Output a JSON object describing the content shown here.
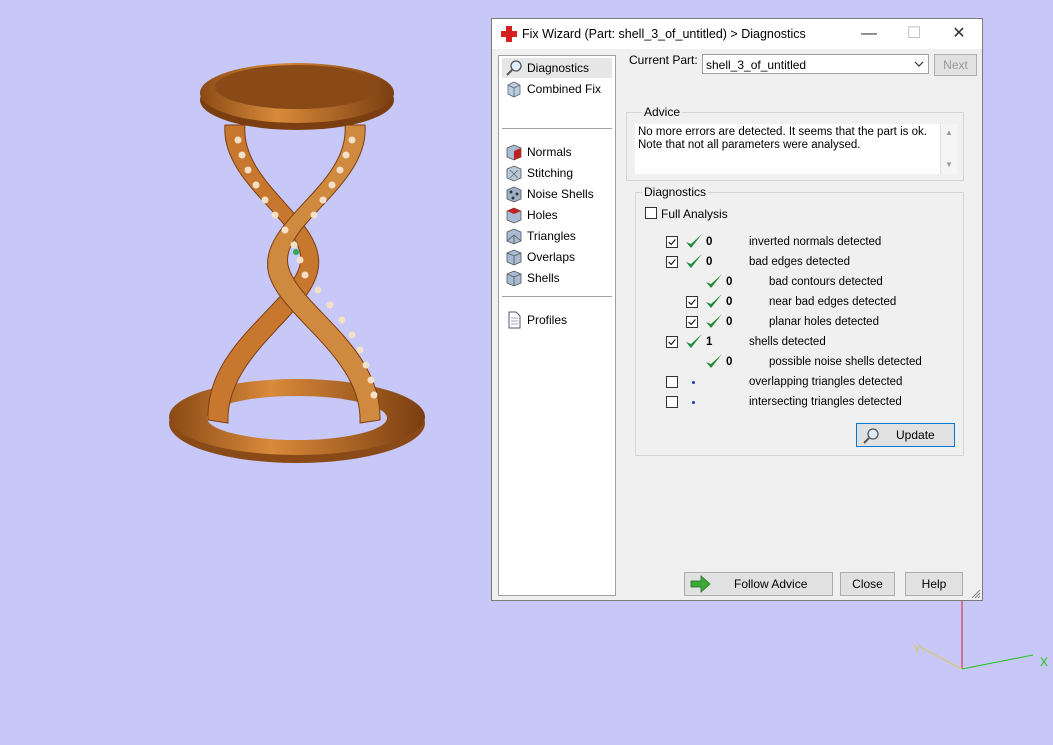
{
  "dialog": {
    "title": "Fix Wizard (Part: shell_3_of_untitled) > Diagnostics",
    "controls": {
      "minimize": "—",
      "maximize": "☐",
      "close": "✕"
    }
  },
  "nav": {
    "items": [
      {
        "label": "Diagnostics",
        "icon": "magnifier-icon",
        "selected": true
      },
      {
        "label": "Combined Fix",
        "icon": "combined-fix-icon"
      },
      {
        "label": "Normals",
        "icon": "normals-cube-icon"
      },
      {
        "label": "Stitching",
        "icon": "stitching-cube-icon"
      },
      {
        "label": "Noise Shells",
        "icon": "noise-shells-cube-icon"
      },
      {
        "label": "Holes",
        "icon": "holes-cube-icon"
      },
      {
        "label": "Triangles",
        "icon": "triangles-cube-icon"
      },
      {
        "label": "Overlaps",
        "icon": "overlaps-cube-icon"
      },
      {
        "label": "Shells",
        "icon": "shells-cube-icon"
      },
      {
        "label": "Profiles",
        "icon": "document-icon"
      }
    ]
  },
  "part": {
    "label": "Current Part:",
    "value": "shell_3_of_untitled",
    "next_label": "Next"
  },
  "advice": {
    "title": "Advice",
    "text": "No more errors are detected. It seems that the part is ok.\nNote that not all parameters were analysed."
  },
  "diagnostics": {
    "title": "Diagnostics",
    "full_analysis_label": "Full Analysis",
    "full_analysis_checked": false,
    "rows": [
      {
        "checked": true,
        "status": "ok",
        "count": "0",
        "label": "inverted normals detected"
      },
      {
        "checked": true,
        "status": "ok",
        "count": "0",
        "label": "bad edges detected"
      },
      {
        "checked": null,
        "status": "ok",
        "count": "0",
        "label": "bad contours detected"
      },
      {
        "checked": true,
        "status": "ok",
        "count": "0",
        "label": "near bad edges detected"
      },
      {
        "checked": true,
        "status": "ok",
        "count": "0",
        "label": "planar holes detected"
      },
      {
        "checked": true,
        "status": "ok",
        "count": "1",
        "label": "shells detected"
      },
      {
        "checked": null,
        "status": "ok",
        "count": "0",
        "label": "possible noise shells detected"
      },
      {
        "checked": false,
        "status": "pending",
        "count": "",
        "label": "overlapping triangles detected"
      },
      {
        "checked": false,
        "status": "pending",
        "count": "",
        "label": "intersecting triangles detected"
      }
    ],
    "update_label": "Update"
  },
  "footer": {
    "follow_advice_label": "Follow Advice",
    "close_label": "Close",
    "help_label": "Help"
  },
  "viewport": {
    "axis_x_label": "X",
    "axis_y_label": "Y"
  },
  "colors": {
    "background": "#c8c8f8",
    "model": "#c0702a",
    "check_green": "#1f8a3a",
    "axis_red": "#e02020",
    "axis_green": "#20c020",
    "axis_yellow": "#d8c860"
  }
}
